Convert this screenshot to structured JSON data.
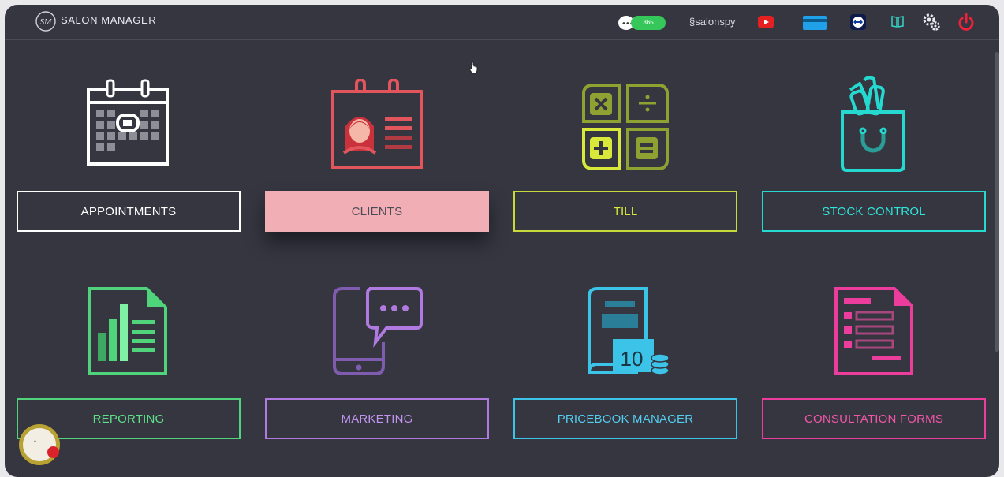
{
  "header": {
    "brand": "SALON MANAGER",
    "logo_text": "SM",
    "sms_count": "365",
    "salonspy": "salonspy"
  },
  "modules": [
    {
      "label": "APPOINTMENTS",
      "icon": "calendar-icon",
      "color": "#ffffff"
    },
    {
      "label": "CLIENTS",
      "icon": "client-card-icon",
      "color": "#e2555d"
    },
    {
      "label": "TILL",
      "icon": "calculator-icon",
      "color": "#c8d93a"
    },
    {
      "label": "STOCK CONTROL",
      "icon": "shopping-bag-icon",
      "color": "#25d9d0"
    },
    {
      "label": "REPORTING",
      "icon": "report-chart-icon",
      "color": "#4fd47c"
    },
    {
      "label": "MARKETING",
      "icon": "phone-chat-icon",
      "color": "#b07ae0"
    },
    {
      "label": "PRICEBOOK MANAGER",
      "icon": "pricebook-icon",
      "color": "#3cc3e8"
    },
    {
      "label": "CONSULTATION FORMS",
      "icon": "form-document-icon",
      "color": "#ec3c9c"
    }
  ],
  "pricebook_badge": "10",
  "colors": {
    "background": "#353640",
    "clients_button_fill": "#f2aeb5"
  }
}
